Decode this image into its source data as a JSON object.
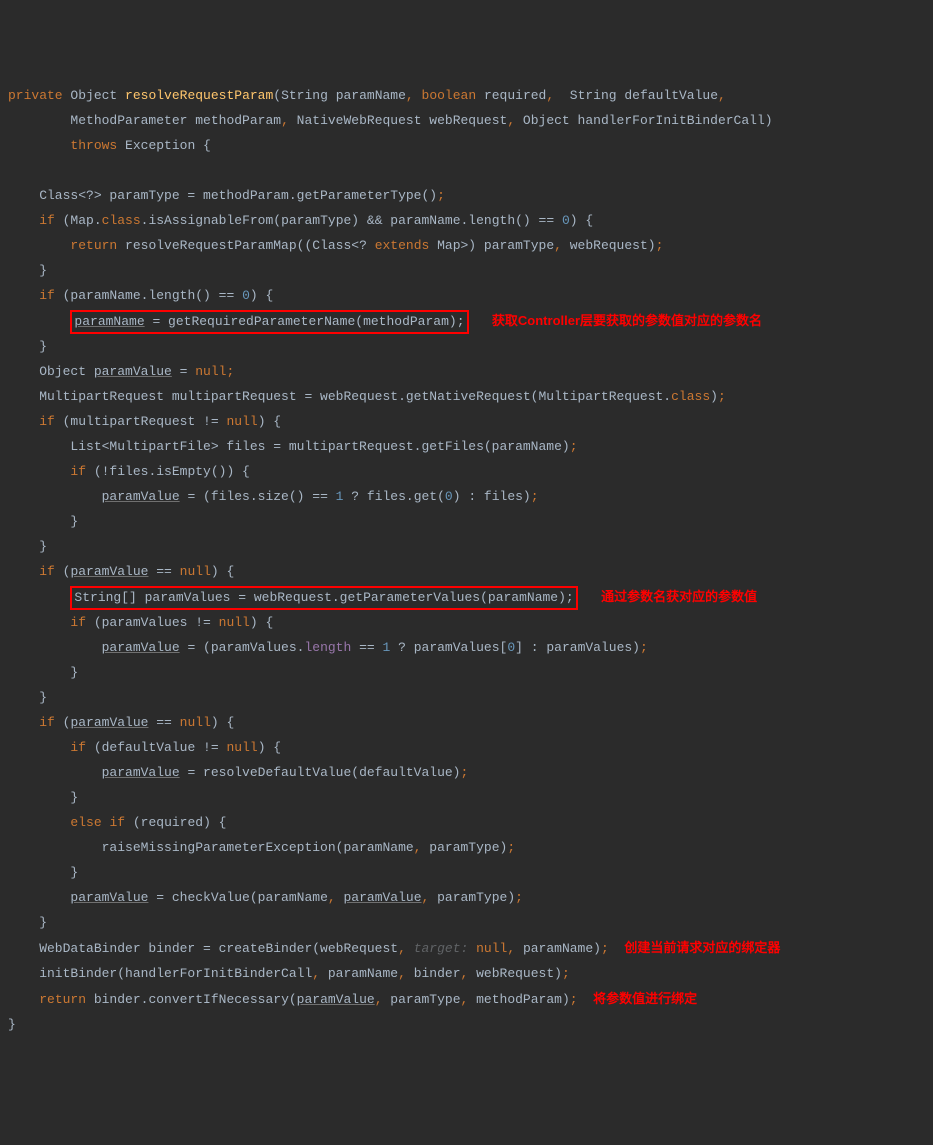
{
  "sig": {
    "private": "private",
    "object": "Object",
    "method": "resolveRequestParam",
    "p1": "(String paramName",
    "c1": ",",
    "boolean": "boolean",
    "required": " required",
    "c2": ",",
    "p3": "  String defaultValue",
    "c3": ",",
    "l2a": "MethodParameter methodParam",
    "c4": ",",
    "l2b": " NativeWebRequest webRequest",
    "c5": ",",
    "l2c": " Object handlerForInitBinderCall)",
    "throws": "throws",
    "exc": " Exception {"
  },
  "b": {
    "l1": "    Class<?> paramType = methodParam.getParameterType()",
    "semi": ";",
    "if": "if",
    "l2a": " (Map.",
    "class": "class",
    "l2b": ".isAssignableFrom(paramType) && paramName.length() == ",
    "zero": "0",
    "l2c": ") {",
    "return": "return",
    "l3a": " resolveRequestParamMap((Class<? ",
    "extends": "extends",
    "l3b": " Map>) paramType",
    "comma": ",",
    "l3c": " webRequest)",
    "rbrace": "    }",
    "l5a": " (paramName.length() == ",
    "l5b": ") {",
    "box1": "paramName",
    "box1b": " = getRequiredParameterName(methodParam);",
    "l8": "    Object ",
    "paramValue": "paramValue",
    "eq": " = ",
    "null": "null",
    "l9a": "    MultipartRequest multipartRequest = webRequest.getNativeRequest(MultipartRequest.",
    "l9b": ")",
    "l10a": " (multipartRequest != ",
    "l10b": ") {",
    "l11": "        List<MultipartFile> files = multipartRequest.getFiles(paramName)",
    "l12a": " (!files.isEmpty()) {",
    "l13a": " = (files.size() == ",
    "one": "1",
    "l13b": " ? files.get(",
    "l13c": ") : files)",
    "rb2": "        }",
    "l16a": " (",
    "l16b": " == ",
    "l16c": ") {",
    "box2": "String[] paramValues = webRequest.getParameterValues(paramName);",
    "l18a": " (paramValues != ",
    "l18b": ") {",
    "l19a": " = (paramValues.",
    "length": "length",
    "l19b": " == ",
    "l19c": " ? paramValues[",
    "l19d": "] : paramValues)",
    "l23a": " (defaultValue != ",
    "l23b": ") {",
    "l24a": " = resolveDefaultValue(defaultValue)",
    "else": "else",
    "l26a": " (required) {",
    "l27a": "            raiseMissingParameterException(paramName",
    "l27b": " paramType)",
    "l29a": " = checkValue(paramName",
    "l29b": " paramType)",
    "l31a": "    WebDataBinder binder = createBinder(webRequest",
    "target": " target: ",
    "l31b": " paramName)",
    "l32a": "    initBinder(handlerForInitBinderCall",
    "l32b": " paramName",
    "l32c": " binder",
    "l32d": " webRequest)",
    "l33a": " binder.convertIfNecessary(",
    "l33b": " paramType",
    "l33c": " methodParam)",
    "end": "}"
  },
  "anno": {
    "a1": "获取Controller层要获取的参数值对应的参数名",
    "a2": "通过参数名获对应的参数值",
    "a3": "创建当前请求对应的绑定器",
    "a4": "将参数值进行绑定"
  }
}
